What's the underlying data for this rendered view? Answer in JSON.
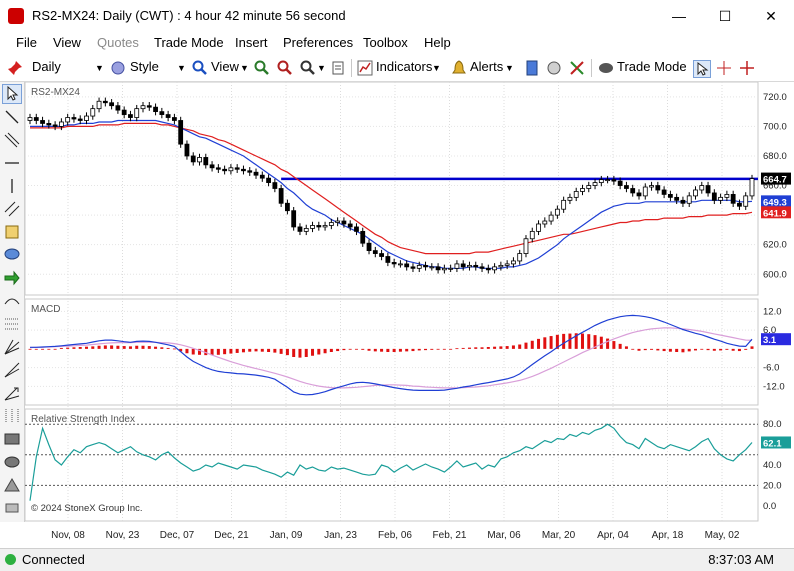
{
  "window": {
    "title": "RS2-MX24: Daily (CWT) : 4 hour 42 minute 56 second",
    "minimize": "—",
    "maximize": "☐",
    "close": "✕"
  },
  "menu": [
    "File",
    "View",
    "Quotes",
    "Trade Mode",
    "Insert",
    "Preferences",
    "Toolbox",
    "Help"
  ],
  "toolbar": {
    "interval": "Daily",
    "style": "Style",
    "view": "View",
    "indicators": "Indicators",
    "alerts": "Alerts",
    "trade_mode": "Trade Mode"
  },
  "status": {
    "connection": "Connected",
    "time": "8:37:03 AM"
  },
  "colors": {
    "candle_up": "#ffffff",
    "candle_down": "#000000",
    "sma_short": "#1f3fd4",
    "sma_long": "#e01f1f",
    "hline": "#0000cc",
    "macd_hist": "#e01010",
    "macd_line": "#1f3fd4",
    "macd_signal": "#d99fd9",
    "rsi": "#1a9e99",
    "macd_label": "#2a2ae0"
  },
  "chart_data": [
    {
      "type": "candlestick",
      "panel": "price",
      "title": "RS2-MX24",
      "copyright": "© 2024 StoneX Group Inc.",
      "x_ticks": [
        "Nov, 08",
        "Nov, 23",
        "Dec, 07",
        "Dec, 21",
        "Jan, 09",
        "Jan, 23",
        "Feb, 06",
        "Feb, 21",
        "Mar, 06",
        "Mar, 20",
        "Apr, 04",
        "Apr, 18",
        "May, 02"
      ],
      "y_ticks": [
        600.0,
        620.0,
        640.0,
        660.0,
        680.0,
        700.0,
        720.0
      ],
      "ylim": [
        588,
        728
      ],
      "horizontal_line": 664.5,
      "last_price": "664.7",
      "sma_short_last": "649.3",
      "sma_long_last": "641.9",
      "closes": [
        706,
        704,
        702,
        701,
        700,
        703,
        706,
        705,
        704,
        707,
        712,
        717,
        716,
        714,
        711,
        708,
        706,
        712,
        714,
        713,
        710,
        708,
        706,
        704,
        688,
        680,
        676,
        679,
        674,
        672,
        671,
        670,
        672,
        671,
        670,
        669,
        667,
        665,
        662,
        658,
        648,
        643,
        632,
        629,
        631,
        633,
        632,
        633,
        635,
        636,
        634,
        632,
        629,
        621,
        616,
        614,
        612,
        608,
        607,
        607,
        605,
        604,
        606,
        605,
        605,
        603,
        604,
        604,
        607,
        605,
        606,
        605,
        604,
        603,
        605,
        606,
        607,
        609,
        614,
        624,
        629,
        634,
        636,
        640,
        644,
        650,
        652,
        656,
        658,
        660,
        662,
        664,
        664,
        663,
        660,
        658,
        655,
        653,
        659,
        660,
        657,
        654,
        652,
        650,
        648,
        653,
        657,
        660,
        655,
        650,
        652,
        654,
        648,
        646,
        653,
        664.7
      ],
      "sma_short": [
        700,
        700,
        700,
        700,
        700,
        700,
        701,
        701,
        702,
        702,
        702,
        703,
        703,
        703,
        704,
        704,
        704,
        704,
        704,
        704,
        704,
        703,
        702,
        701,
        699,
        697,
        695,
        693,
        692,
        690,
        688,
        686,
        684,
        682,
        680,
        677,
        674,
        671,
        668,
        665,
        662,
        658,
        655,
        651,
        647,
        644,
        642,
        640,
        637,
        635,
        633,
        631,
        629,
        627,
        624,
        621,
        618,
        615,
        613,
        611,
        609,
        608,
        607,
        606,
        605,
        605,
        604,
        604,
        604,
        604,
        605,
        605,
        604,
        604,
        604,
        604,
        605,
        605,
        606,
        607,
        609,
        611,
        614,
        617,
        620,
        624,
        627,
        630,
        633,
        636,
        639,
        642,
        644,
        646,
        647,
        648,
        648,
        648,
        649,
        649,
        649,
        649,
        649,
        649,
        649,
        649,
        649,
        650,
        650,
        650,
        650,
        650,
        650,
        649,
        649,
        649.3
      ],
      "sma_long": [
        699,
        699,
        699,
        699,
        699,
        699,
        700,
        700,
        700,
        700,
        700,
        701,
        701,
        701,
        701,
        702,
        702,
        702,
        702,
        702,
        702,
        701,
        701,
        700,
        699,
        698,
        697,
        695,
        694,
        693,
        691,
        690,
        688,
        686,
        684,
        682,
        680,
        678,
        676,
        674,
        671,
        669,
        666,
        663,
        660,
        657,
        654,
        651,
        648,
        645,
        642,
        639,
        636,
        633,
        630,
        627,
        625,
        622,
        620,
        618,
        617,
        616,
        615,
        614,
        614,
        614,
        614,
        614,
        614,
        614,
        614,
        615,
        615,
        615,
        616,
        617,
        618,
        619,
        620,
        621,
        622,
        623,
        624,
        625,
        626,
        627,
        627,
        628,
        629,
        630,
        631,
        632,
        633,
        634,
        635,
        635,
        636,
        636,
        637,
        637,
        637,
        638,
        638,
        638,
        638,
        639,
        639,
        639,
        640,
        640,
        640,
        640,
        641,
        641,
        641,
        641.9
      ]
    },
    {
      "type": "bar",
      "panel": "macd",
      "title": "MACD",
      "y_ticks": [
        -12.0,
        -6.0,
        6.0,
        12.0
      ],
      "ylim": [
        -17,
        15
      ],
      "last_value": "3.1",
      "histogram": [
        0,
        0,
        0,
        0,
        0,
        0.3,
        0.4,
        0.5,
        0.6,
        0.7,
        0.8,
        1.0,
        1.1,
        1.1,
        1.0,
        0.9,
        0.8,
        1.0,
        1.0,
        0.9,
        0.7,
        0.5,
        0.3,
        0.1,
        -0.8,
        -1.4,
        -1.8,
        -1.9,
        -2.0,
        -2.0,
        -1.9,
        -1.7,
        -1.5,
        -1.3,
        -1.1,
        -0.9,
        -0.8,
        -0.9,
        -1.0,
        -1.2,
        -1.6,
        -2.0,
        -2.6,
        -2.8,
        -2.6,
        -2.2,
        -1.8,
        -1.4,
        -1.0,
        -0.7,
        -0.4,
        -0.2,
        -0.1,
        -0.3,
        -0.6,
        -0.8,
        -0.9,
        -1.0,
        -1.0,
        -0.9,
        -0.8,
        -0.7,
        -0.5,
        -0.4,
        -0.3,
        -0.2,
        -0.1,
        0.0,
        0.2,
        0.3,
        0.4,
        0.5,
        0.5,
        0.6,
        0.7,
        0.8,
        0.9,
        1.1,
        1.4,
        2.0,
        2.6,
        3.2,
        3.7,
        4.1,
        4.5,
        4.8,
        4.9,
        5.0,
        4.9,
        4.7,
        4.4,
        3.9,
        3.3,
        2.5,
        1.6,
        0.8,
        0.0,
        -0.6,
        -0.4,
        -0.3,
        -0.5,
        -0.7,
        -0.9,
        -1.0,
        -1.1,
        -0.8,
        -0.5,
        -0.2,
        -0.4,
        -0.6,
        -0.5,
        -0.3,
        -0.6,
        -0.7,
        -0.3,
        0.8
      ],
      "macd_line": [
        0.5,
        0.5,
        0.6,
        0.7,
        0.8,
        1.0,
        1.2,
        1.4,
        1.6,
        1.8,
        2.2,
        2.6,
        2.8,
        2.8,
        2.6,
        2.3,
        2.1,
        2.4,
        2.5,
        2.4,
        2.1,
        1.7,
        1.3,
        0.8,
        -0.9,
        -2.6,
        -4.0,
        -5.0,
        -6.0,
        -6.7,
        -7.2,
        -7.5,
        -7.7,
        -7.9,
        -8.0,
        -8.2,
        -8.4,
        -8.7,
        -9.1,
        -9.7,
        -11.0,
        -12.3,
        -13.8,
        -14.5,
        -14.7,
        -14.6,
        -14.2,
        -13.7,
        -13.0,
        -12.4,
        -11.8,
        -11.2,
        -10.8,
        -10.7,
        -10.9,
        -11.2,
        -11.6,
        -12.0,
        -12.4,
        -12.7,
        -13.0,
        -13.2,
        -13.3,
        -13.3,
        -13.3,
        -13.3,
        -13.2,
        -12.9,
        -12.6,
        -12.2,
        -11.9,
        -11.5,
        -11.1,
        -10.8,
        -10.4,
        -10.0,
        -9.6,
        -9.0,
        -8.0,
        -6.5,
        -5.0,
        -3.6,
        -2.2,
        -0.9,
        0.5,
        1.8,
        3.0,
        4.2,
        5.3,
        6.4,
        7.5,
        8.4,
        9.2,
        9.8,
        10.3,
        10.6,
        10.7,
        10.6,
        10.3,
        9.9,
        9.3,
        8.6,
        7.8,
        7.0,
        6.2,
        5.6,
        5.0,
        4.5,
        3.8,
        3.1,
        2.5,
        1.8,
        1.3,
        0.9,
        0.8,
        3.1
      ],
      "signal_line": [
        0.4,
        0.5,
        0.5,
        0.6,
        0.7,
        0.8,
        0.9,
        1.0,
        1.1,
        1.2,
        1.4,
        1.6,
        1.8,
        1.9,
        2.0,
        2.0,
        2.0,
        2.1,
        2.1,
        2.1,
        2.1,
        2.0,
        1.9,
        1.7,
        1.3,
        0.8,
        0.2,
        -0.5,
        -1.2,
        -2.0,
        -2.7,
        -3.4,
        -4.1,
        -4.7,
        -5.3,
        -5.8,
        -6.3,
        -6.8,
        -7.3,
        -7.8,
        -8.4,
        -9.0,
        -9.7,
        -10.4,
        -11.0,
        -11.5,
        -11.9,
        -12.2,
        -12.4,
        -12.5,
        -12.5,
        -12.4,
        -12.3,
        -12.1,
        -11.9,
        -11.7,
        -11.6,
        -11.5,
        -11.5,
        -11.6,
        -11.7,
        -11.9,
        -12.0,
        -12.2,
        -12.3,
        -12.4,
        -12.5,
        -12.5,
        -12.5,
        -12.4,
        -12.3,
        -12.2,
        -12.0,
        -11.8,
        -11.5,
        -11.2,
        -10.9,
        -10.5,
        -10.1,
        -9.5,
        -8.8,
        -8.0,
        -7.1,
        -6.2,
        -5.2,
        -4.2,
        -3.2,
        -2.2,
        -1.2,
        -0.3,
        0.6,
        1.5,
        2.4,
        3.2,
        3.9,
        4.6,
        5.2,
        5.7,
        6.1,
        6.4,
        6.6,
        6.7,
        6.7,
        6.6,
        6.4,
        6.2,
        5.9,
        5.6,
        5.2,
        4.8,
        4.4,
        4.0,
        3.6,
        3.2,
        2.8,
        2.7
      ]
    },
    {
      "type": "line",
      "panel": "rsi",
      "title": "Relative Strength Index",
      "y_ticks": [
        0.0,
        20.0,
        40.0,
        60.0,
        80.0
      ],
      "ylim": [
        -12,
        92
      ],
      "levels": [
        20,
        50,
        80
      ],
      "last_value": "62.1",
      "values": [
        5,
        48,
        76,
        60,
        45,
        40,
        48,
        55,
        52,
        58,
        60,
        62,
        60,
        56,
        52,
        55,
        58,
        53,
        50,
        48,
        45,
        50,
        53,
        47,
        42,
        38,
        34,
        36,
        40,
        38,
        42,
        40,
        38,
        36,
        40,
        39,
        38,
        35,
        33,
        31,
        28,
        33,
        30,
        40,
        36,
        38,
        35,
        34,
        38,
        36,
        37,
        35,
        33,
        31,
        30,
        31,
        40,
        38,
        33,
        37,
        40,
        35,
        38,
        41,
        38,
        36,
        33,
        38,
        44,
        38,
        40,
        42,
        36,
        40,
        38,
        46,
        48,
        52,
        54,
        58,
        56,
        60,
        64,
        62,
        66,
        65,
        70,
        68,
        72,
        70,
        74,
        76,
        80,
        76,
        68,
        62,
        60,
        56,
        66,
        62,
        58,
        56,
        60,
        58,
        56,
        54,
        58,
        63,
        66,
        56,
        50,
        46,
        44,
        50,
        55,
        62.1
      ]
    }
  ]
}
